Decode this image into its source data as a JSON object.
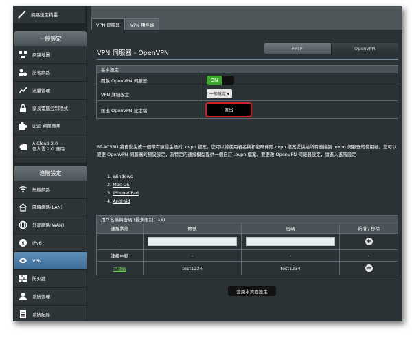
{
  "sidebar": {
    "top_item": "網路設定精靈",
    "general_header": "一般設定",
    "general_items": [
      {
        "label": "網路地圖",
        "icon": "globe-icon"
      },
      {
        "label": "訪客網路",
        "icon": "guest-network-icon"
      },
      {
        "label": "流量管理",
        "icon": "traffic-icon"
      },
      {
        "label": "家長電腦控制程式",
        "icon": "lock-icon"
      },
      {
        "label": "USB 相關應用",
        "icon": "puzzle-icon"
      },
      {
        "label_line1": "AiCloud 2.0",
        "label_line2": "個人雲 2.0 應用",
        "icon": "cloud-icon"
      }
    ],
    "advanced_header": "進階設定",
    "advanced_items": [
      {
        "label": "無線網路",
        "icon": "wifi-icon"
      },
      {
        "label": "區域網路(LAN)",
        "icon": "home-icon"
      },
      {
        "label": "外部網路(WAN)",
        "icon": "globe-icon"
      },
      {
        "label": "IPv6",
        "icon": "ipv6-icon"
      },
      {
        "label": "VPN",
        "icon": "vpn-icon"
      },
      {
        "label": "防火牆",
        "icon": "firewall-icon"
      },
      {
        "label": "系統管理",
        "icon": "person-icon"
      },
      {
        "label": "系統紀錄",
        "icon": "log-icon"
      }
    ]
  },
  "tabs": [
    "VPN 伺服器",
    "VPN 用戶端"
  ],
  "page_title": "VPN 伺服器 - OpenVPN",
  "protocol": {
    "pptp": "PPTP",
    "openvpn": "OpenVPN"
  },
  "basic": {
    "header": "基本設定",
    "enable_label": "開啟 OpenVPN 伺服器",
    "toggle_on": "ON",
    "detail_label": "VPN 詳細設定",
    "detail_value": "一般設定 ▾",
    "export_label": "匯出 OpenVPN 設定檔",
    "export_button": "匯出"
  },
  "description": "RT-AC58U 將自動生成一個帶有驗證金鑰的 .ovpn 檔案。您可以將使用者名稱和密碼伴隨.ovpn 檔案提供給所有連接到 .ovpn 伺服器的使用者。您可以變更 OpenVPN 伺服器的預設設定，為特定的連接模型提供一個自訂 .ovpn 檔案。要更改 OpenVPN 伺服器設定，請進入進階設定",
  "platforms": [
    "Windows",
    "Mac OS",
    "iPhone/iPad",
    "Android"
  ],
  "users": {
    "header": "用戶名稱與密碼 (最多限制：16)",
    "columns": [
      "連線狀態",
      "帳號",
      "密碼",
      "新增 / 移除"
    ],
    "rows": [
      {
        "status": "-",
        "account": "",
        "password": "",
        "action": "add"
      },
      {
        "status": "連線中斷",
        "account": "-",
        "password": "-",
        "action": "-"
      },
      {
        "status": "已連線",
        "account": "test1234",
        "password": "test1234",
        "action": "remove"
      }
    ]
  },
  "apply_button": "套用本頁面設定"
}
